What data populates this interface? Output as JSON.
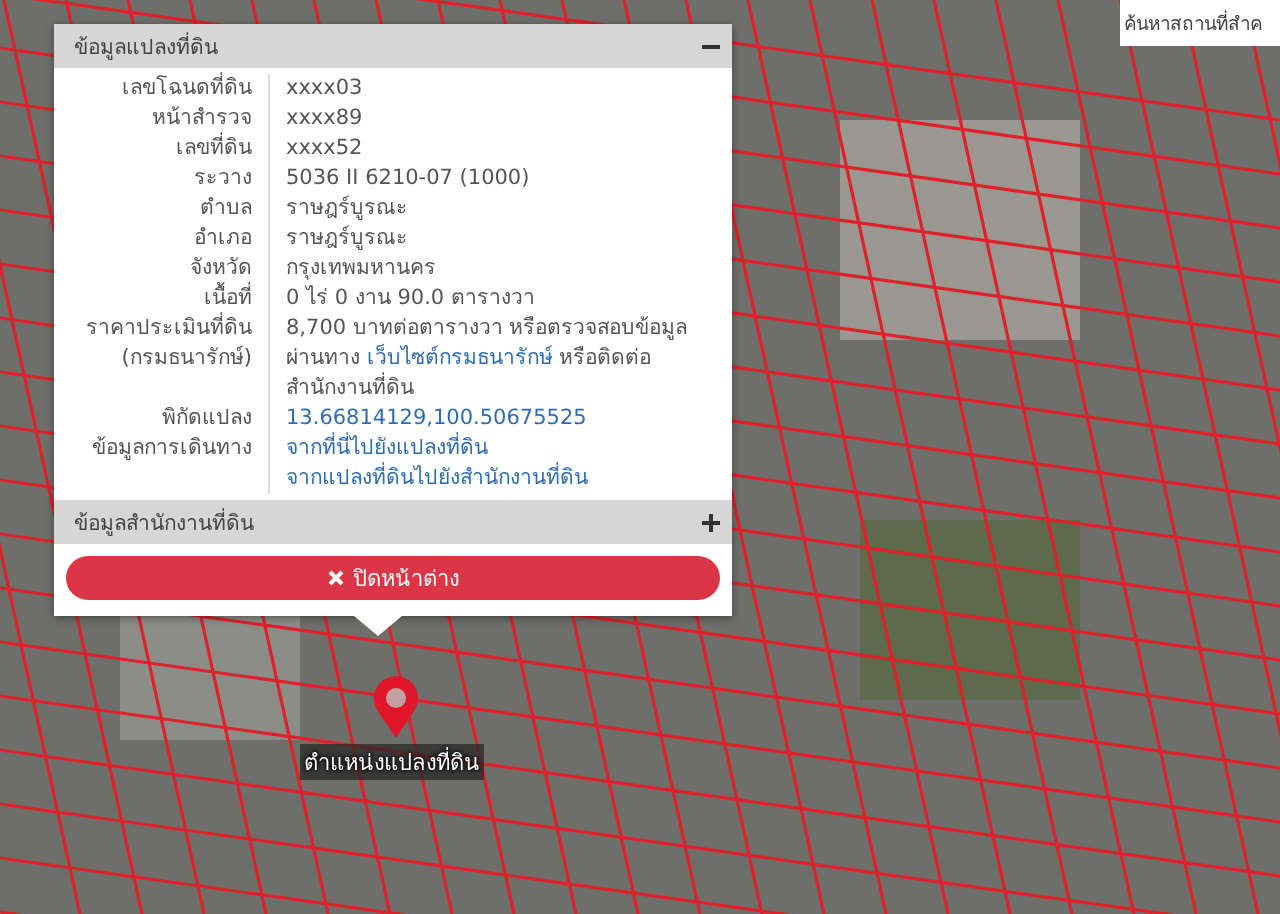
{
  "search": {
    "placeholder": "ค้นหาสถานที่สำค"
  },
  "popup": {
    "sections": [
      {
        "title": "ข้อมูลแปลงที่ดิน",
        "expanded": true
      },
      {
        "title": "ข้อมูลสำนักงานที่ดิน",
        "expanded": false
      }
    ],
    "rows": [
      {
        "label": "เลขโฉนดที่ดิน",
        "value": [
          {
            "text": "xxxx03",
            "kind": "text"
          }
        ]
      },
      {
        "label": "หน้าสำรวจ",
        "value": [
          {
            "text": "xxxx89",
            "kind": "text"
          }
        ]
      },
      {
        "label": "เลขที่ดิน",
        "value": [
          {
            "text": "xxxx52",
            "kind": "text"
          }
        ]
      },
      {
        "label": "ระวาง",
        "value": [
          {
            "text": "5036 II 6210-07 (1000)",
            "kind": "text"
          }
        ]
      },
      {
        "label": "ตำบล",
        "value": [
          {
            "text": "ราษฎร์บูรณะ",
            "kind": "text"
          }
        ]
      },
      {
        "label": "อำเภอ",
        "value": [
          {
            "text": "ราษฎร์บูรณะ",
            "kind": "text"
          }
        ]
      },
      {
        "label": "จังหวัด",
        "value": [
          {
            "text": "กรุงเทพมหานคร",
            "kind": "text"
          }
        ]
      },
      {
        "label": "เนื้อที่",
        "value": [
          {
            "text": "0 ไร่ 0 งาน 90.0 ตารางวา",
            "kind": "text"
          }
        ]
      },
      {
        "label": "ราคาประเมินที่ดิน\n(กรมธนารักษ์)",
        "value": [
          {
            "text": "8,700 บาทต่อตารางวา หรือตรวจสอบข้อมูลผ่านทาง ",
            "kind": "text"
          },
          {
            "text": "เว็บไซต์กรมธนารักษ์",
            "kind": "link"
          },
          {
            "text": " หรือติดต่อสำนักงานที่ดิน",
            "kind": "text"
          }
        ]
      },
      {
        "label": "พิกัดแปลง",
        "links": [
          "13.66814129,100.50675525"
        ]
      },
      {
        "label": "ข้อมูลการเดินทาง",
        "links": [
          "จากที่นี่ไปยังแปลงที่ดิน",
          "จากแปลงที่ดินไปยังสำนักงานที่ดิน"
        ]
      }
    ],
    "close_button": "ปิดหน้าต่าง"
  },
  "marker": {
    "label": "ตำแหน่งแปลงที่ดิน"
  }
}
